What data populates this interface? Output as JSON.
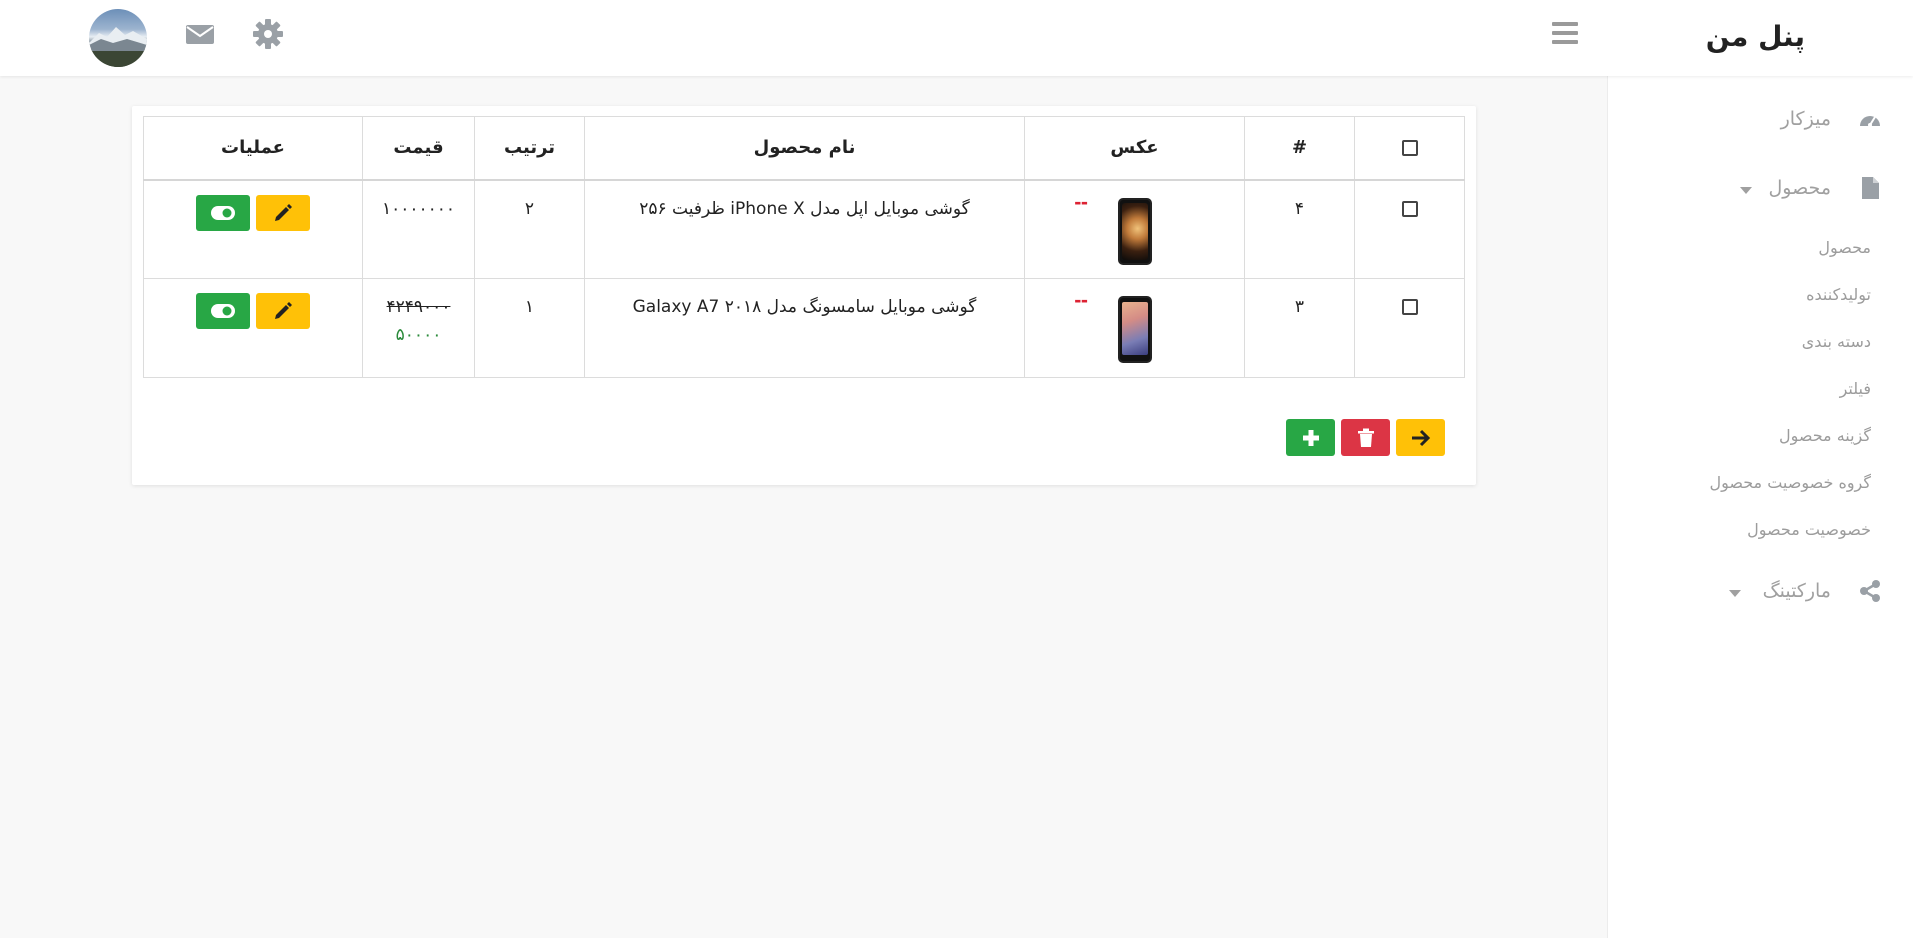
{
  "header": {
    "brand": "پنل من",
    "icons": {
      "menu": "hamburger-icon",
      "settings": "gear-icon",
      "messages": "mail-icon",
      "avatar": "user-avatar"
    }
  },
  "sidebar": {
    "items": [
      {
        "label": "میزکار",
        "icon": "dashboard-icon"
      },
      {
        "label": "محصول",
        "icon": "file-icon",
        "expanded": true
      },
      {
        "label": "مارکتینگ",
        "icon": "share-icon"
      }
    ],
    "subitems": [
      "محصول",
      "تولیدکننده",
      "دسته بندی",
      "فیلتر",
      "گزینه محصول",
      "گروه خصوصیت محصول",
      "خصوصیت محصول"
    ]
  },
  "table": {
    "headers": {
      "id": "#",
      "image": "عکس",
      "name": "نام محصول",
      "sort": "ترتیب",
      "price": "قیمت",
      "actions": "عملیات"
    },
    "rows": [
      {
        "id": "۴",
        "name": "گوشی موبایل اپل مدل iPhone X ظرفیت ۲۵۶",
        "sort": "۲",
        "price": "۱۰۰۰۰۰۰۰",
        "special": ""
      },
      {
        "id": "۳",
        "name": "گوشی موبایل سامسونگ مدل Galaxy A7 ۲۰۱۸",
        "sort": "۱",
        "price": "۴۲۴۹۰۰۰",
        "special": "۵۰۰۰۰"
      }
    ]
  },
  "colors": {
    "green": "#28a745",
    "yellow": "#ffc107",
    "red": "#dc3545"
  }
}
